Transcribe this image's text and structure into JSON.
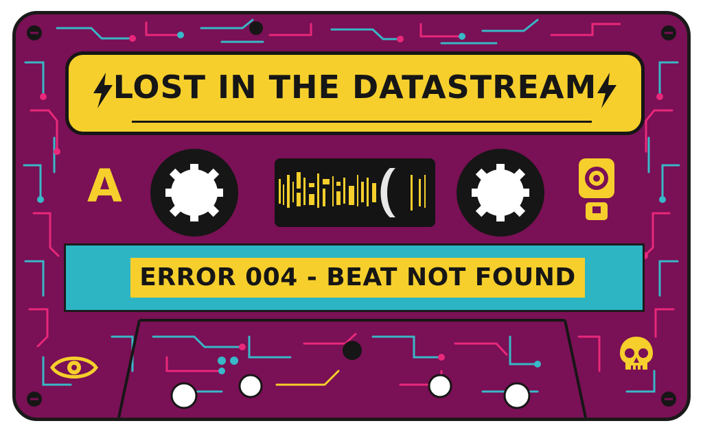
{
  "cassette": {
    "title": "LOST IN THE DATASTREAM",
    "side": "A",
    "error_message": "ERROR 004 - BEAT NOT FOUND"
  },
  "icons": {
    "title_left": "lightning-bolt-icon",
    "title_right": "lightning-bolt-icon",
    "top_right": "speaker-icon",
    "bottom_left": "eye-icon",
    "bottom_right": "skull-icon"
  },
  "colors": {
    "body": "#7a1055",
    "label_yellow": "#f6cf2c",
    "band_teal": "#2eb5c4",
    "circuit_pink": "#e8287a",
    "circuit_teal": "#38b8c8",
    "outline": "#161616"
  }
}
